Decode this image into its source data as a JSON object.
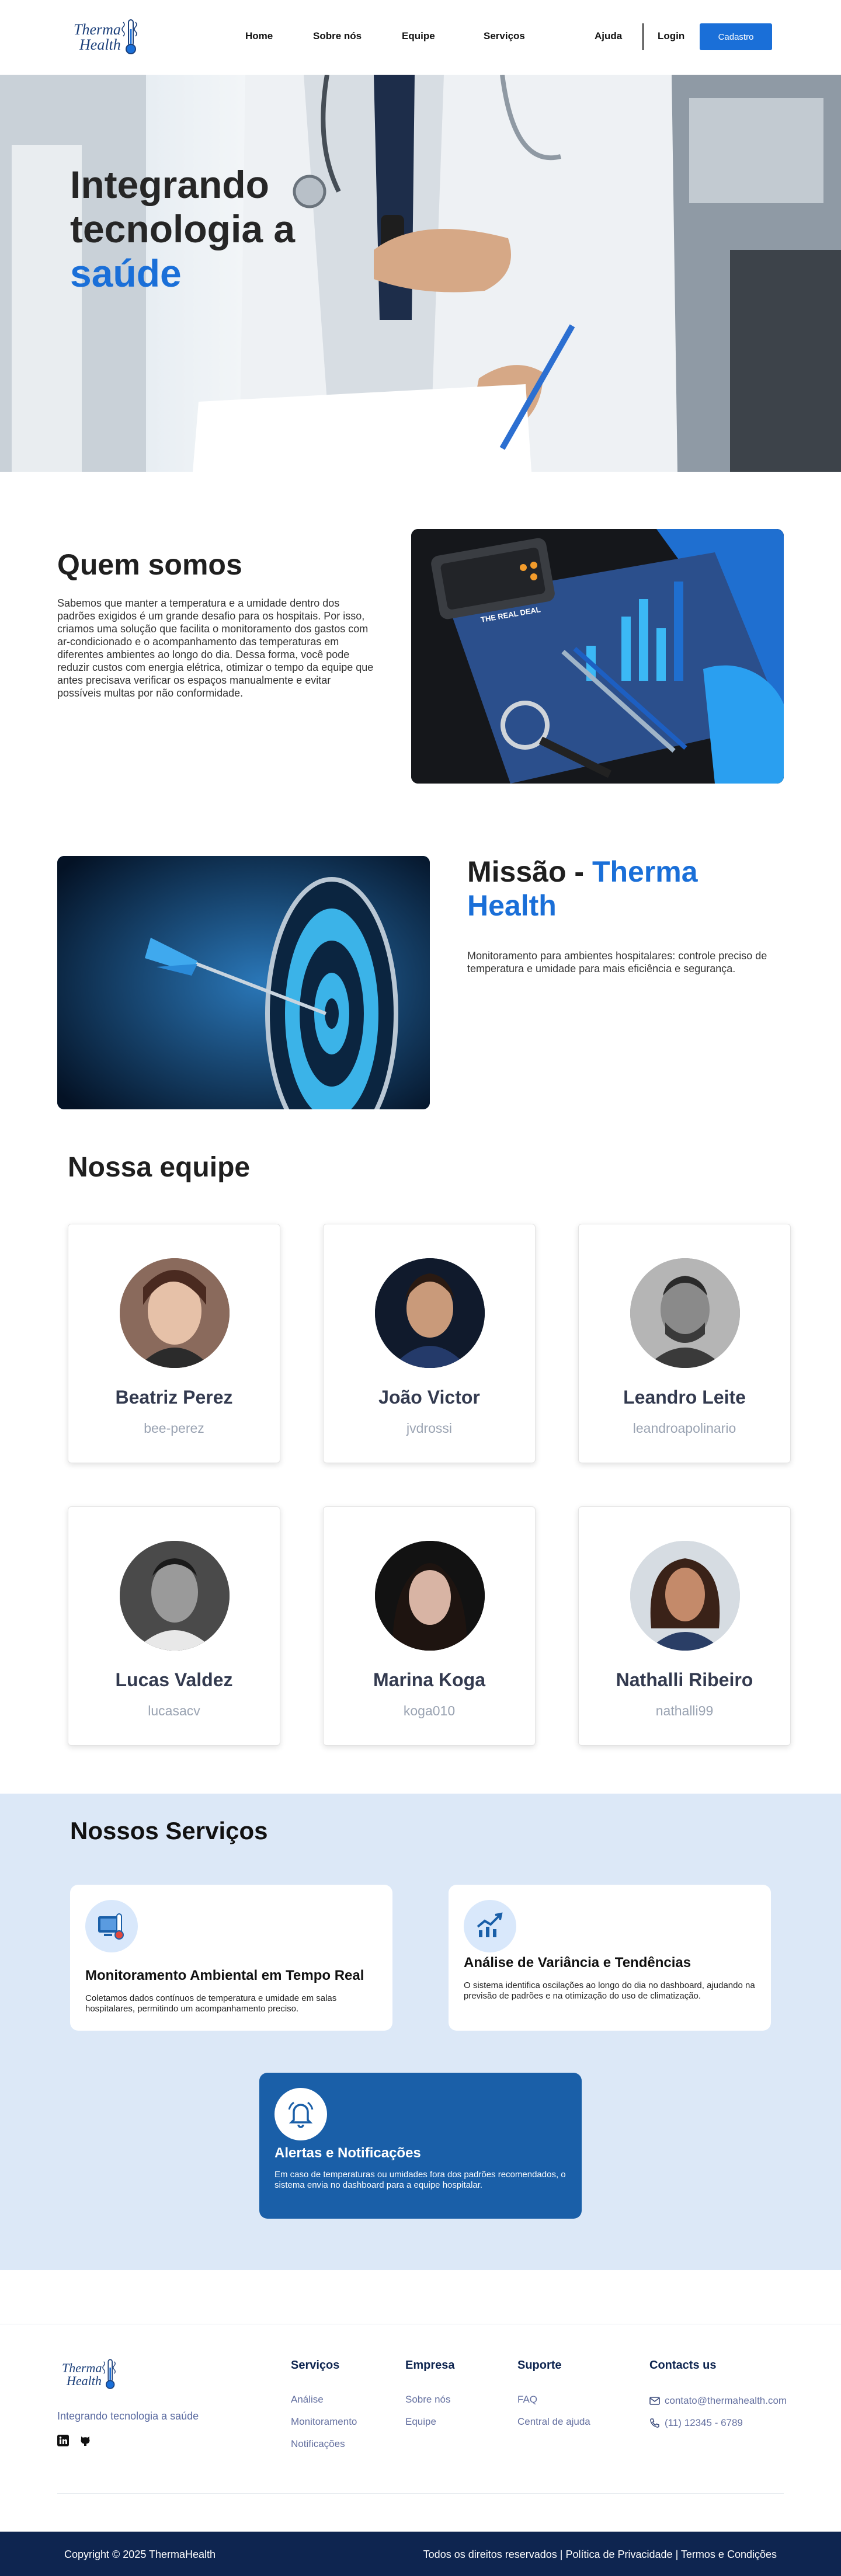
{
  "nav": {
    "logo_line1": "Therma",
    "logo_line2": "Health",
    "links": [
      "Home",
      "Sobre nós",
      "Equipe",
      "Serviços"
    ],
    "help": "Ajuda",
    "login": "Login",
    "signup": "Cadastro"
  },
  "hero": {
    "title_line1": "Integrando",
    "title_line2": "tecnologia a",
    "title_accent": "saúde"
  },
  "about": {
    "title": "Quem somos",
    "text": "Sabemos que manter a temperatura e a umidade dentro dos padrões exigidos é um grande desafio para os hospitais. Por isso, criamos uma solução que facilita o monitoramento dos gastos com ar-condicionado e o acompanhamento das temperaturas em diferentes ambientes ao longo do dia. Dessa forma, você pode reduzir custos com energia elétrica, otimizar o tempo da equipe que antes precisava verificar os espaços manualmente e evitar possíveis multas por não conformidade.",
    "image_text": "THE REAL DEAL"
  },
  "mission": {
    "title_prefix": "Missão - ",
    "title_accent": "Therma Health",
    "text": "Monitoramento para ambientes hospitalares: controle preciso de temperatura e umidade para mais eficiência e segurança."
  },
  "team": {
    "title": "Nossa equipe",
    "members": [
      {
        "name": "Beatriz Perez",
        "user": "bee-perez"
      },
      {
        "name": "João Victor",
        "user": "jvdrossi"
      },
      {
        "name": "Leandro Leite",
        "user": "leandroapolinario"
      },
      {
        "name": "Lucas Valdez",
        "user": "lucasacv"
      },
      {
        "name": "Marina Koga",
        "user": "koga010"
      },
      {
        "name": "Nathalli Ribeiro",
        "user": "nathalli99"
      }
    ]
  },
  "services": {
    "title": "Nossos Serviços",
    "items": [
      {
        "title": "Monitoramento Ambiental em Tempo Real",
        "text": "Coletamos dados contínuos de temperatura e umidade em salas hospitalares, permitindo um acompanhamento preciso.",
        "icon": "thermometer-monitor-icon"
      },
      {
        "title": "Análise de Variância e Tendências",
        "text": "O sistema identifica oscilações ao longo do dia no dashboard, ajudando na previsão de padrões e na otimização do uso de climatização.",
        "icon": "trend-chart-icon"
      },
      {
        "title": "Alertas e Notificações",
        "text": "Em caso de temperaturas ou umidades fora dos padrões recomendados, o sistema envia no dashboard para a equipe hospitalar.",
        "icon": "bell-icon"
      }
    ]
  },
  "footer": {
    "tagline": "Integrando tecnologia a saúde",
    "col_services": {
      "title": "Serviços",
      "links": [
        "Análise",
        "Monitoramento",
        "Notificações"
      ]
    },
    "col_company": {
      "title": "Empresa",
      "links": [
        "Sobre nós",
        "Equipe"
      ]
    },
    "col_support": {
      "title": "Suporte",
      "links": [
        "FAQ",
        "Central de ajuda"
      ]
    },
    "col_contact": {
      "title": "Contacts us",
      "email": "contato@thermahealth.com",
      "phone": "(11) 12345 - 6789"
    },
    "copyright": "Copyright © 2025 ThermaHealth",
    "legal": "Todos os direitos reservados | Política de Privacidade | Termos e Condições"
  },
  "colors": {
    "accent": "#1a6fd8",
    "footer_bar": "#0e2550",
    "services_bg": "#dce8f7"
  }
}
